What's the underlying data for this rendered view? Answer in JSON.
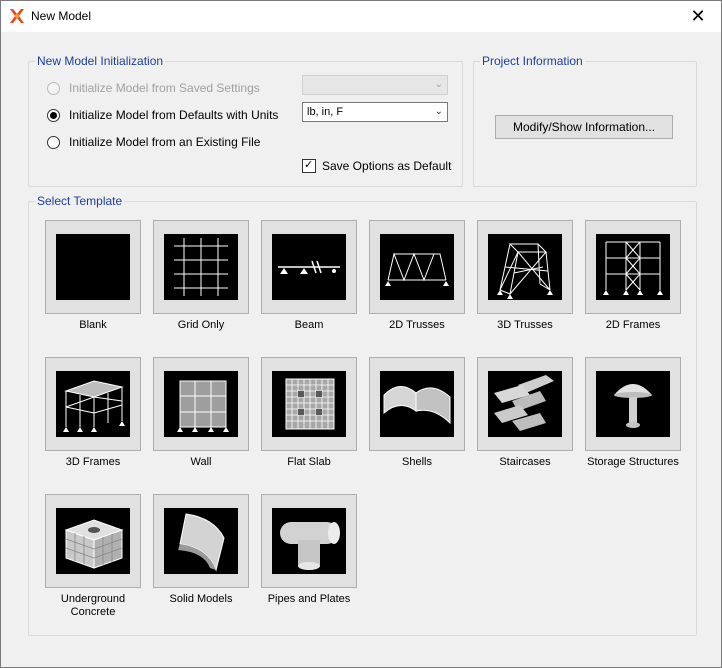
{
  "window": {
    "title": "New Model",
    "close_glyph": "✕",
    "icon": "x-icon",
    "icon_colors": [
      "#e04b1b",
      "#f2a12c"
    ]
  },
  "init_group": {
    "label": "New Model Initialization",
    "options": [
      {
        "label": "Initialize Model from Saved Settings",
        "state": "disabled"
      },
      {
        "label": "Initialize Model from Defaults with Units",
        "state": "checked"
      },
      {
        "label": "Initialize Model from an Existing File",
        "state": "unchecked"
      }
    ],
    "saved_settings_combo": {
      "value": ""
    },
    "units_combo": {
      "value": "lb, in, F"
    },
    "save_default": {
      "label": "Save Options as Default",
      "checked": true
    }
  },
  "project_group": {
    "label": "Project Information",
    "button": "Modify/Show Information..."
  },
  "templates": {
    "label": "Select Template",
    "items": [
      {
        "label": "Blank"
      },
      {
        "label": "Grid Only"
      },
      {
        "label": "Beam"
      },
      {
        "label": "2D Trusses"
      },
      {
        "label": "3D Trusses"
      },
      {
        "label": "2D Frames"
      },
      {
        "label": "3D Frames"
      },
      {
        "label": "Wall"
      },
      {
        "label": "Flat Slab"
      },
      {
        "label": "Shells"
      },
      {
        "label": "Staircases"
      },
      {
        "label": "Storage Structures"
      },
      {
        "label": "Underground\nConcrete"
      },
      {
        "label": "Solid Models"
      },
      {
        "label": "Pipes and Plates"
      }
    ]
  },
  "colors": {
    "group_label": "#1a3e9a",
    "tile_bg": "#e1e1e1",
    "image_bg": "#000000"
  }
}
